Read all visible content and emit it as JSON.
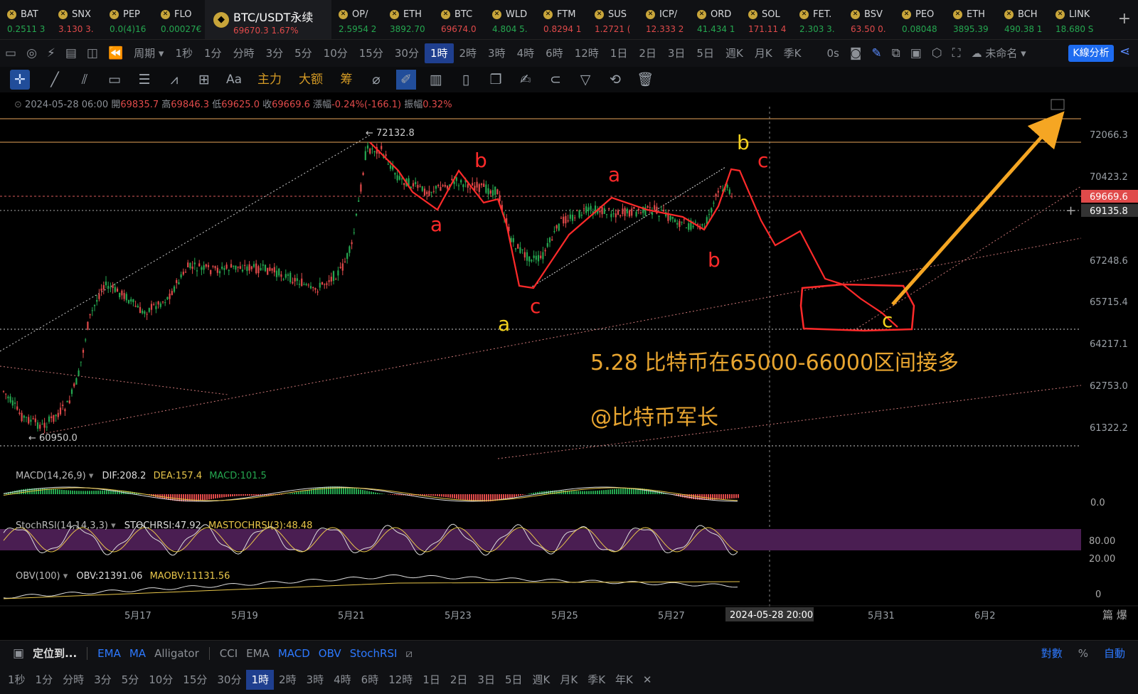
{
  "ticker": [
    {
      "sym": "BAT",
      "px": "0.2511 3",
      "dir": "up",
      "icon": "coin-icon"
    },
    {
      "sym": "SNX",
      "px": "3.130 3.",
      "dir": "dn",
      "icon": "coin-icon"
    },
    {
      "sym": "PEP",
      "px": "0.0(4)16",
      "dir": "up",
      "icon": "coin-icon"
    },
    {
      "sym": "FLO",
      "px": "0.00027€",
      "dir": "up",
      "icon": "coin-icon"
    },
    {
      "sym": "BTC/USDT永续",
      "px": "69670.3 1.67%",
      "dir": "dn",
      "icon": "binance-icon",
      "active": true
    },
    {
      "sym": "OP/",
      "px": "2.5954 2",
      "dir": "up",
      "icon": "coin-icon"
    },
    {
      "sym": "ETH",
      "px": "3892.70",
      "dir": "up",
      "icon": "coin-icon"
    },
    {
      "sym": "BTC",
      "px": "69674.0",
      "dir": "dn",
      "icon": "coin-icon"
    },
    {
      "sym": "WLD",
      "px": "4.804 5.",
      "dir": "up",
      "icon": "coin-icon"
    },
    {
      "sym": "FTM",
      "px": "0.8294 1",
      "dir": "dn",
      "icon": "coin-icon"
    },
    {
      "sym": "SUS",
      "px": "1.2721 (",
      "dir": "dn",
      "icon": "coin-icon"
    },
    {
      "sym": "ICP/",
      "px": "12.333 2",
      "dir": "dn",
      "icon": "coin-icon"
    },
    {
      "sym": "ORD",
      "px": "41.434 1",
      "dir": "up",
      "icon": "coin-icon"
    },
    {
      "sym": "SOL",
      "px": "171.11 4",
      "dir": "dn",
      "icon": "coin-icon"
    },
    {
      "sym": "FET.",
      "px": "2.303 3.",
      "dir": "up",
      "icon": "coin-icon"
    },
    {
      "sym": "BSV",
      "px": "63.50 0.",
      "dir": "dn",
      "icon": "coin-icon"
    },
    {
      "sym": "PEO",
      "px": "0.08048",
      "dir": "up",
      "icon": "coin-icon"
    },
    {
      "sym": "ETH",
      "px": "3895.39",
      "dir": "up",
      "icon": "coin-icon"
    },
    {
      "sym": "BCH",
      "px": "490.38 1",
      "dir": "up",
      "icon": "coin-icon"
    },
    {
      "sym": "LINK",
      "px": "18.680 S",
      "dir": "up",
      "icon": "coin-icon"
    }
  ],
  "toolbar1": {
    "period_label": "周期",
    "intervals": [
      "1秒",
      "1分",
      "分時",
      "3分",
      "5分",
      "10分",
      "15分",
      "30分",
      "1時",
      "2時",
      "3時",
      "4時",
      "6時",
      "12時",
      "1日",
      "2日",
      "3日",
      "5日",
      "週K",
      "月K",
      "季K"
    ],
    "selected": "1時",
    "countdown": "0s",
    "layout_name": "未命名",
    "kline_btn": "K線分析"
  },
  "toolbar2": {
    "main": "主力",
    "volume": "大额",
    "chips": "筹",
    "text": "Aa"
  },
  "ohlc": {
    "date": "2024-05-28 06:00",
    "open_label": "開",
    "open": "69835.7",
    "high_label": "高",
    "high": "69846.3",
    "low_label": "低",
    "low": "69625.0",
    "close_label": "收",
    "close": "69669.6",
    "chg_label": "漲幅",
    "chg": "-0.24%(-166.1)",
    "amp_label": "振幅",
    "amp": "0.32%"
  },
  "chart": {
    "price_labels": [
      "72066.3",
      "70423.2",
      "67248.6",
      "65715.4",
      "64217.1",
      "62753.0",
      "61322.2"
    ],
    "current_price": "69669.6",
    "cursor_price": "69135.8",
    "high_mark": "72132.8",
    "low_mark": "60950.0",
    "date_labels": [
      "5月17",
      "5月19",
      "5月21",
      "5月23",
      "5月25",
      "5月27",
      "5月31",
      "6月2"
    ],
    "cursor_date": "2024-05-28 20:00",
    "annotation_main": "5.28 比特币在65000-66000区间接多",
    "annotation_author": "@比特币军长",
    "wave_labels": [
      "a",
      "b",
      "a",
      "b",
      "a",
      "c",
      "b",
      "c",
      "c"
    ]
  },
  "indicators": {
    "macd": {
      "name": "MACD(14,26,9)",
      "dif": "DIF:208.2",
      "dea": "DEA:157.4",
      "macd": "MACD:101.5",
      "axis": "0.0"
    },
    "stoch": {
      "name": "StochRSI(14,14,3,3)",
      "val": "STOCHRSI:47.92",
      "ma": "MASTOCHRSI(3):48.48",
      "axis_hi": "80.00",
      "axis_lo": "20.00"
    },
    "obv": {
      "name": "OBV(100)",
      "val": "OBV:21391.06",
      "ma": "MAOBV:11131.56",
      "axis": "0"
    }
  },
  "bottom1": {
    "locate": "定位到...",
    "main_ind": [
      "EMA",
      "MA",
      "Alligator"
    ],
    "sub_ind": [
      "CCI",
      "EMA",
      "MACD",
      "OBV",
      "StochRSI"
    ],
    "right": [
      "對數",
      "%",
      "自動"
    ]
  },
  "bottom2": {
    "intervals": [
      "1秒",
      "1分",
      "分時",
      "3分",
      "5分",
      "10分",
      "15分",
      "30分",
      "1時",
      "2時",
      "3時",
      "4時",
      "6時",
      "12時",
      "1日",
      "2日",
      "3日",
      "5日",
      "週K",
      "月K",
      "季K",
      "年K"
    ],
    "selected": "1時"
  },
  "colors": {
    "up": "#25a750",
    "down": "#e04a4a",
    "accent": "#1e6cf0",
    "annot_red": "#ff2a2a",
    "arrow": "#f5a623",
    "text_orange": "#e8a530"
  }
}
